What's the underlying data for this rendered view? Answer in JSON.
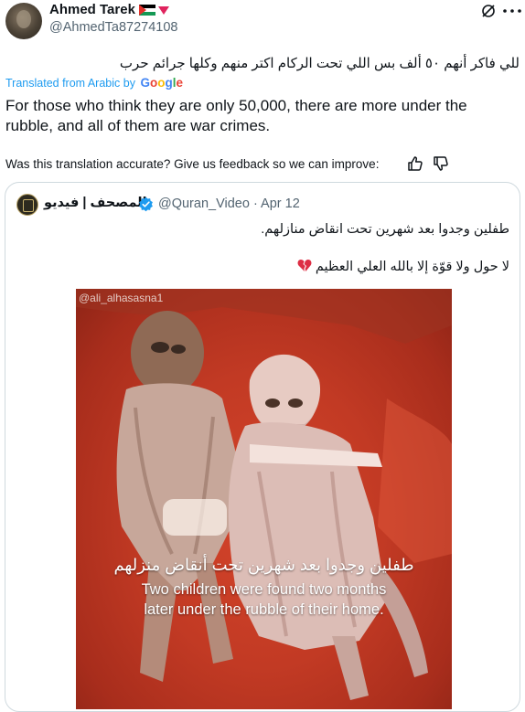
{
  "author": {
    "display_name": "Ahmed Tarek",
    "handle": "@AhmedTa87274108"
  },
  "header_icons": [
    "grok-icon",
    "more-icon"
  ],
  "tweet": {
    "original_text": "للي فاكر أنهم ٥٠ ألف بس اللي تحت الركام اكتر منهم وكلها جرائم حرب",
    "translated_label": "Translated from Arabic by",
    "translator": [
      "G",
      "o",
      "o",
      "g",
      "l",
      "e"
    ],
    "translated_text": "For those who think they are only 50,000, there are more under the rubble, and all of them are war crimes.",
    "feedback_prompt": "Was this translation accurate? Give us feedback so we can improve:"
  },
  "quoted_tweet": {
    "display_name": "المصحف | فيديو",
    "handle": "@Quran_Video",
    "separator": "·",
    "date": "Apr 12",
    "line1": "طفلين وجدوا بعد شهرين تحت انقاض منازلهم.",
    "line2": "لا حول ولا قوّة إلا بالله العلي العظيم",
    "media": {
      "watermark": "@ali_alhasasna1",
      "caption_ar": "طفلين وجدوا بعد شهرين تحت أنقاض منزلهم",
      "caption_en_1": "Two children were found two months",
      "caption_en_2": "later under the rubble of their home."
    }
  },
  "colors": {
    "accent": "#1d9bf0",
    "secondary_text": "#536471",
    "border": "#cfd9de",
    "media_background": "#c23a24"
  }
}
